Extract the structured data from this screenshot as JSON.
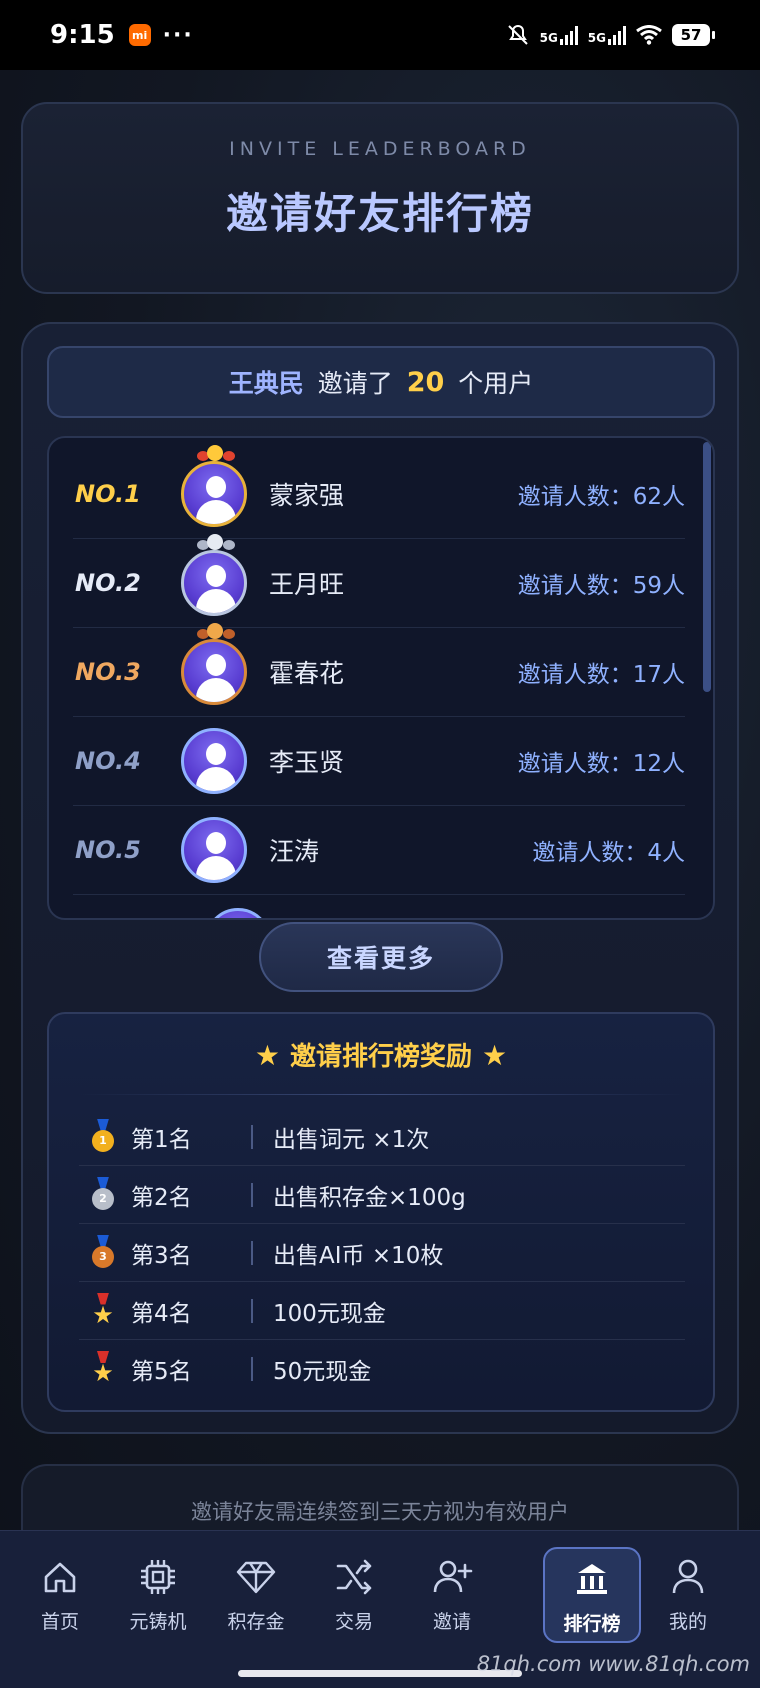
{
  "status_bar": {
    "time": "9:15",
    "mi_badge": "mi",
    "more": "···",
    "signal1": "5G",
    "signal2": "5G",
    "battery": "57"
  },
  "header": {
    "subtitle": "INVITE LEADERBOARD",
    "title": "邀请好友排行榜"
  },
  "invite_summary": {
    "name": "王典民",
    "text1": "邀请了",
    "count": "20",
    "text2": "个用户"
  },
  "leaderboard": {
    "rows": [
      {
        "rank": "NO.1",
        "name": "蒙家强",
        "count": "邀请人数：62人",
        "rank_color": "#ffcf4a",
        "medal": "gold"
      },
      {
        "rank": "NO.2",
        "name": "王月旺",
        "count": "邀请人数：59人",
        "rank_color": "#e6ebf7",
        "medal": "silver"
      },
      {
        "rank": "NO.3",
        "name": "霍春花",
        "count": "邀请人数：17人",
        "rank_color": "#f0a860",
        "medal": "bronze"
      },
      {
        "rank": "NO.4",
        "name": "李玉贤",
        "count": "邀请人数：12人",
        "rank_color": "#8fa0c8",
        "medal": "none"
      },
      {
        "rank": "NO.5",
        "name": "汪涛",
        "count": "邀请人数：4人",
        "rank_color": "#8fa0c8",
        "medal": "none"
      }
    ],
    "more_button": "查看更多"
  },
  "rewards": {
    "title": "邀请排行榜奖励",
    "rows": [
      {
        "rank": "第1名",
        "prize": "出售词元 ×1次",
        "icon": "gold-medal-icon"
      },
      {
        "rank": "第2名",
        "prize": "出售积存金×100g",
        "icon": "silver-medal-icon"
      },
      {
        "rank": "第3名",
        "prize": "出售AI币 ×10枚",
        "icon": "bronze-medal-icon"
      },
      {
        "rank": "第4名",
        "prize": "100元现金",
        "icon": "star-medal-icon"
      },
      {
        "rank": "第5名",
        "prize": "50元现金",
        "icon": "star-medal-icon"
      }
    ]
  },
  "note": "邀请好友需连续签到三天方视为有效用户",
  "tabs": [
    {
      "label": "首页",
      "icon": "home-icon"
    },
    {
      "label": "元铸机",
      "icon": "chip-icon"
    },
    {
      "label": "积存金",
      "icon": "diamond-icon"
    },
    {
      "label": "交易",
      "icon": "shuffle-icon"
    },
    {
      "label": "邀请",
      "icon": "add-user-icon"
    },
    {
      "label": "排行榜",
      "icon": "bank-icon",
      "active": true
    },
    {
      "label": "我的",
      "icon": "user-icon"
    }
  ],
  "watermark": "81qh.com www.81qh.com"
}
